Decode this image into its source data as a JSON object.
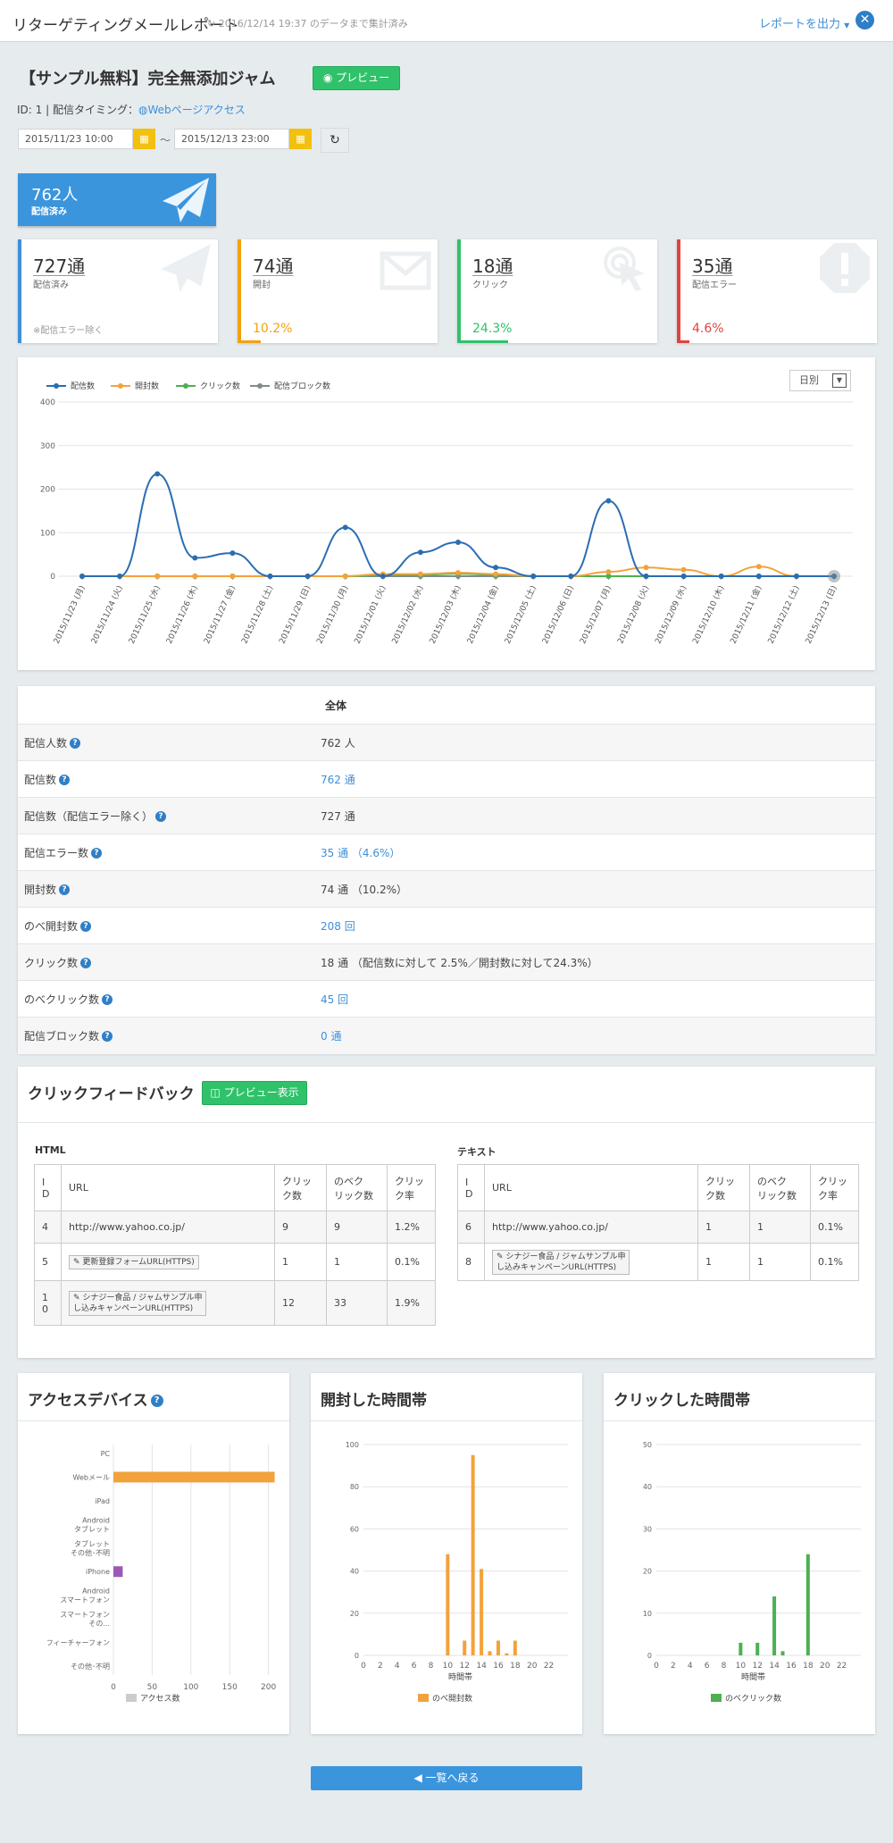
{
  "header": {
    "title": "リターゲティングメールレポート",
    "updated": "2016/12/14 19:37 のデータまで集計済み",
    "report_button": "レポートを出力",
    "close": "✕"
  },
  "campaign": {
    "title": "【サンプル無料】完全無添加ジャム",
    "preview_button": "プレビュー",
    "meta_prefix": "ID: 1 | 配信タイミング：",
    "timing_link": "Webページアクセス",
    "date_from": "2015/11/23 10:00",
    "date_to": "2015/12/13 23:00",
    "tilde": "〜"
  },
  "delivered": {
    "value": "762人",
    "label": "配信済み"
  },
  "stats": [
    {
      "value": "727通",
      "label": "配信済み",
      "note": "※配信エラー除く",
      "color": "#3d8fd6",
      "fill": 1.0
    },
    {
      "value": "74通",
      "label": "開封",
      "percent": "10.2%",
      "color": "#f2a20f",
      "fill": 0.102
    },
    {
      "value": "18通",
      "label": "クリック",
      "percent": "24.3%",
      "color": "#2fc26a",
      "fill": 0.243
    },
    {
      "value": "35通",
      "label": "配信エラー",
      "percent": "4.6%",
      "color": "#e2433f",
      "fill": 0.046
    }
  ],
  "trend_chart": {
    "period_select": "日別",
    "legend": [
      "配信数",
      "開封数",
      "クリック数",
      "配信ブロック数"
    ],
    "colors": [
      "#2a6db2",
      "#f2a23c",
      "#4cb050",
      "#7f8c8d"
    ],
    "ylim": [
      0,
      400
    ],
    "yticks": [
      "400",
      "300",
      "200",
      "100",
      "0"
    ],
    "x": [
      "2015/11/23 (月)",
      "2015/11/24 (火)",
      "2015/11/25 (水)",
      "2015/11/26 (木)",
      "2015/11/27 (金)",
      "2015/11/28 (土)",
      "2015/11/29 (日)",
      "2015/11/30 (月)",
      "2015/12/01 (火)",
      "2015/12/02 (水)",
      "2015/12/03 (木)",
      "2015/12/04 (金)",
      "2015/12/05 (土)",
      "2015/12/06 (日)",
      "2015/12/07 (月)",
      "2015/12/08 (火)",
      "2015/12/09 (水)",
      "2015/12/10 (木)",
      "2015/12/11 (金)",
      "2015/12/12 (土)",
      "2015/12/13 (日)"
    ],
    "series": [
      {
        "name": "配信数",
        "values": [
          0,
          0,
          235,
          42,
          53,
          0,
          0,
          112,
          0,
          55,
          78,
          20,
          0,
          0,
          173,
          0,
          0,
          0,
          0,
          0,
          0
        ]
      },
      {
        "name": "開封数",
        "values": [
          0,
          0,
          0,
          0,
          0,
          0,
          0,
          0,
          5,
          5,
          8,
          5,
          0,
          0,
          10,
          20,
          15,
          0,
          22,
          0,
          0
        ]
      },
      {
        "name": "クリック数",
        "values": [
          0,
          0,
          0,
          0,
          0,
          0,
          0,
          0,
          2,
          3,
          6,
          3,
          0,
          0,
          0,
          0,
          0,
          0,
          0,
          0,
          0
        ]
      },
      {
        "name": "配信ブロック数",
        "values": [
          0,
          0,
          0,
          0,
          0,
          0,
          0,
          0,
          0,
          0,
          0,
          0,
          0,
          0,
          0,
          0,
          0,
          0,
          0,
          0,
          0
        ]
      }
    ]
  },
  "summary": {
    "header": "全体",
    "rows": [
      {
        "label": "配信人数",
        "value": "762 人",
        "link": false
      },
      {
        "label": "配信数",
        "value": "762 通",
        "link": true
      },
      {
        "label": "配信数（配信エラー除く）",
        "value": "727 通",
        "link": false
      },
      {
        "label": "配信エラー数",
        "value": "35 通 （4.6%）",
        "link": true
      },
      {
        "label": "開封数",
        "value": "74 通 （10.2%）",
        "link": false
      },
      {
        "label": "のべ開封数",
        "value": "208 回",
        "link": true
      },
      {
        "label": "クリック数",
        "value": "18 通 （配信数に対して 2.5%／開封数に対して24.3%）",
        "link": false
      },
      {
        "label": "のべクリック数",
        "value": "45 回",
        "link": true
      },
      {
        "label": "配信ブロック数",
        "value": "0 通",
        "link": true
      }
    ]
  },
  "feedback": {
    "title": "クリックフィードバック",
    "preview_button": "プレビュー表示",
    "html": {
      "label": "HTML",
      "headers": [
        "I\nD",
        "URL",
        "クリッ\nク数",
        "のベク\nリック数",
        "クリッ\nク率"
      ],
      "rows": [
        [
          "4",
          "http://www.yahoo.co.jp/",
          "9",
          "9",
          "1.2%"
        ],
        [
          "5",
          "更新登録フォームURL(HTTPS)",
          "1",
          "1",
          "0.1%"
        ],
        [
          "1\n0",
          "シナジー食品 / ジャムサンプル申\nし込みキャンペーンURL(HTTPS)",
          "12",
          "33",
          "1.9%"
        ]
      ]
    },
    "text": {
      "label": "テキスト",
      "headers": [
        "I\nD",
        "URL",
        "クリッ\nク数",
        "のベク\nリック数",
        "クリッ\nク率"
      ],
      "rows": [
        [
          "6",
          "http://www.yahoo.co.jp/",
          "1",
          "1",
          "0.1%"
        ],
        [
          "8",
          "シナジー食品 / ジャムサンプル申\nし込みキャンペーンURL(HTTPS)",
          "1",
          "1",
          "0.1%"
        ]
      ]
    }
  },
  "chart_data": [
    {
      "type": "bar",
      "title": "アクセスデバイス",
      "orientation": "horizontal",
      "categories": [
        "PC",
        "Webメール",
        "iPad",
        "Android タブレット",
        "タブレット その他･不明",
        "iPhone",
        "Android スマートフォン",
        "スマートフォン その...",
        "フィーチャーフォン",
        "その他･不明"
      ],
      "series": [
        {
          "name": "アクセス数",
          "values": [
            0,
            208,
            0,
            0,
            0,
            12,
            0,
            0,
            0,
            0
          ]
        }
      ],
      "bar_colors": [
        "#cccccc",
        "#f2a23c",
        "#cccccc",
        "#cccccc",
        "#cccccc",
        "#9b59b6",
        "#cccccc",
        "#cccccc",
        "#cccccc",
        "#cccccc"
      ],
      "xlim": [
        0,
        220
      ],
      "xticks": [
        "0",
        "50",
        "100",
        "150",
        "200"
      ],
      "legend": "bottom"
    },
    {
      "type": "bar",
      "title": "開封した時間帯",
      "categories": [
        "0",
        "1",
        "2",
        "3",
        "4",
        "5",
        "6",
        "7",
        "8",
        "9",
        "10",
        "11",
        "12",
        "13",
        "14",
        "15",
        "16",
        "17",
        "18",
        "19",
        "20",
        "21",
        "22",
        "23"
      ],
      "xticks": [
        "0",
        "2",
        "4",
        "6",
        "8",
        "10",
        "12",
        "14",
        "16",
        "18",
        "20",
        "22"
      ],
      "series": [
        {
          "name": "のべ開封数",
          "values": [
            0,
            0,
            0,
            0,
            0,
            0,
            0,
            0,
            0,
            0,
            48,
            0,
            7,
            95,
            41,
            2,
            7,
            1,
            7,
            0,
            0,
            0,
            0,
            0
          ]
        }
      ],
      "xlabel": "時間帯",
      "ylim": [
        0,
        100
      ],
      "yticks": [
        "100",
        "80",
        "60",
        "40",
        "20",
        "0"
      ],
      "color": "#f2a23c"
    },
    {
      "type": "bar",
      "title": "クリックした時間帯",
      "categories": [
        "0",
        "1",
        "2",
        "3",
        "4",
        "5",
        "6",
        "7",
        "8",
        "9",
        "10",
        "11",
        "12",
        "13",
        "14",
        "15",
        "16",
        "17",
        "18",
        "19",
        "20",
        "21",
        "22",
        "23"
      ],
      "xticks": [
        "0",
        "2",
        "4",
        "6",
        "8",
        "10",
        "12",
        "14",
        "16",
        "18",
        "20",
        "22"
      ],
      "series": [
        {
          "name": "のベクリック数",
          "values": [
            0,
            0,
            0,
            0,
            0,
            0,
            0,
            0,
            0,
            0,
            3,
            0,
            3,
            0,
            14,
            1,
            0,
            0,
            24,
            0,
            0,
            0,
            0,
            0
          ]
        }
      ],
      "xlabel": "時間帯",
      "ylim": [
        0,
        50
      ],
      "yticks": [
        "50",
        "40",
        "30",
        "20",
        "10",
        "0"
      ],
      "color": "#4cb050"
    }
  ],
  "back_button": "一覧へ戻る"
}
